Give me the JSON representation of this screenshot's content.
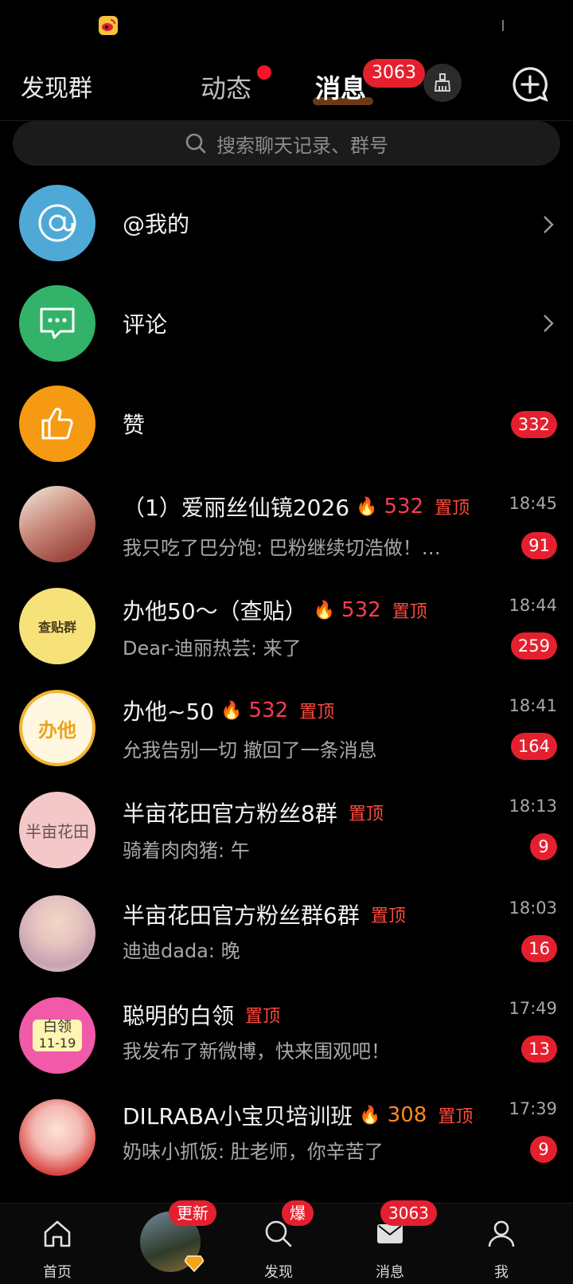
{
  "top_nav": {
    "discover_groups": "发现群",
    "tab_activity": "动态",
    "tab_messages": "消息",
    "messages_badge": "3063"
  },
  "search": {
    "placeholder": "搜索聊天记录、群号"
  },
  "system_rows": [
    {
      "label": "@我的",
      "icon": "at-icon",
      "color": "#4fa9d6"
    },
    {
      "label": "评论",
      "icon": "comment-icon",
      "color": "#33b36a"
    },
    {
      "label": "赞",
      "icon": "thumbs-up-icon",
      "color": "#f59a12",
      "count": "332"
    }
  ],
  "chats": [
    {
      "title": "（1）爱丽丝仙镜2026",
      "fire_icon": "purple-fire-icon",
      "heat": "532",
      "pinned": "置顶",
      "preview": "我只吃了巴分饱: 巴粉继续切浩做！…",
      "time": "18:45",
      "unread": "91"
    },
    {
      "title": "办他50～（查贴）",
      "fire_icon": "purple-fire-icon",
      "heat": "532",
      "pinned": "置顶",
      "preview": "Dear-迪丽热芸: 来了",
      "time": "18:44",
      "unread": "259",
      "avatar_text": "查贴群"
    },
    {
      "title": "办他~50",
      "fire_icon": "purple-fire-icon",
      "heat": "532",
      "pinned": "置顶",
      "preview": "允我告别一切 撤回了一条消息",
      "time": "18:41",
      "unread": "164",
      "avatar_text": "办他"
    },
    {
      "title": "半亩花田官方粉丝8群",
      "pinned": "置顶",
      "preview": "骑着肉肉猪: 午",
      "time": "18:13",
      "unread": "9",
      "avatar_text": "半亩花田"
    },
    {
      "title": "半亩花田官方粉丝群6群",
      "pinned": "置顶",
      "preview": "迪迪dada: 晚",
      "time": "18:03",
      "unread": "16"
    },
    {
      "title": "聪明的白领",
      "pinned": "置顶",
      "preview": "我发布了新微博，快来围观吧！",
      "time": "17:49",
      "unread": "13",
      "avatar_text": "白领",
      "avatar_text2": "11-19"
    },
    {
      "title": "DILRABA小宝贝培训班",
      "fire_icon": "orange-fire-icon",
      "heat": "308",
      "pinned": "置顶",
      "preview": "奶味小抓饭: 肚老师，你辛苦了",
      "time": "17:39",
      "unread": "9"
    }
  ],
  "bottom_nav": {
    "home": "首页",
    "update_badge": "更新",
    "discover": "发现",
    "discover_badge": "爆",
    "messages": "消息",
    "messages_badge": "3063",
    "me": "我"
  },
  "colors": {
    "badge_red": "#e4202f",
    "pin_red": "#ff4a3d",
    "heat_pink": "#ff3b55",
    "heat_orange": "#ff8a1e"
  }
}
